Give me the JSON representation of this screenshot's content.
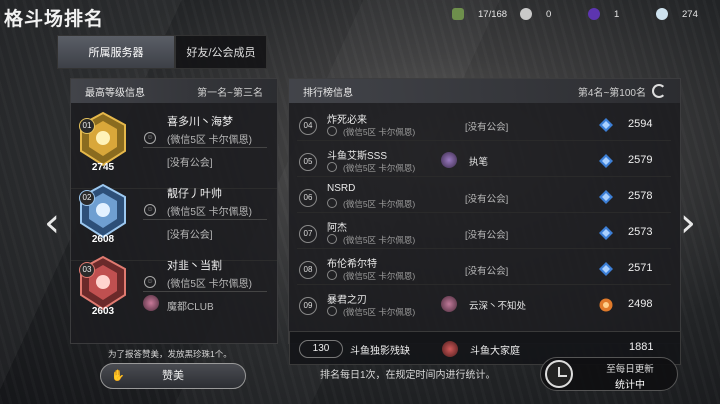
{
  "title": "格斗场排名",
  "resources": [
    {
      "icon": "green-box-icon",
      "value": "17/168",
      "color": "#7fa35a"
    },
    {
      "icon": "silver-ball-icon",
      "value": "0",
      "color": "#c9c9c9"
    },
    {
      "icon": "purple-gem-icon",
      "value": "1",
      "color": "#7a4bd3"
    },
    {
      "icon": "diamond-icon",
      "value": "274",
      "color": "#cfe3ef"
    }
  ],
  "tabs": [
    "所属服务器",
    "好友/公会成员"
  ],
  "left_panel": {
    "header": "最高等级信息",
    "range": "第一名~第三名",
    "top3": [
      {
        "rank": "01",
        "score": "2745",
        "name": "喜多川丶海梦",
        "server": "(微信5区 卡尔佩恩)",
        "guild": "[没有公会]",
        "color": "#e6b84a"
      },
      {
        "rank": "02",
        "score": "2608",
        "name": "靓仔丿叶帅",
        "server": "(微信5区 卡尔佩恩)",
        "guild": "[没有公会]",
        "color": "#7fb2e6"
      },
      {
        "rank": "03",
        "score": "2603",
        "name": "对韭丶当割",
        "server": "(微信5区 卡尔佩恩)",
        "guild": "魔都CLUB",
        "color": "#d0605a"
      }
    ]
  },
  "right_panel": {
    "header": "排行榜信息",
    "range": "第4名~第100名",
    "rows": [
      {
        "num": "04",
        "name": "炸死必来",
        "server": "(微信5区 卡尔佩恩)",
        "guild": "[没有公会]",
        "has_emblem": false,
        "points": "2594",
        "rank_color": "#3c7fd6"
      },
      {
        "num": "05",
        "name": "斗鱼艾斯SSS",
        "server": "(微信5区 卡尔佩恩)",
        "guild": "执笔",
        "has_emblem": true,
        "points": "2579",
        "rank_color": "#3c7fd6"
      },
      {
        "num": "06",
        "name": "NSRD",
        "server": "(微信5区 卡尔佩恩)",
        "guild": "[没有公会]",
        "has_emblem": false,
        "points": "2578",
        "rank_color": "#3c7fd6"
      },
      {
        "num": "07",
        "name": "阿杰",
        "server": "(微信5区 卡尔佩恩)",
        "guild": "[没有公会]",
        "has_emblem": false,
        "points": "2573",
        "rank_color": "#3c7fd6"
      },
      {
        "num": "08",
        "name": "布伦希尔特",
        "server": "(微信5区 卡尔佩恩)",
        "guild": "[没有公会]",
        "has_emblem": false,
        "points": "2571",
        "rank_color": "#3c7fd6"
      },
      {
        "num": "09",
        "name": "暴君之刃",
        "server": "(微信5区 卡尔佩恩)",
        "guild": "云深丶不知处",
        "has_emblem": true,
        "points": "2498",
        "rank_color": "#e07a2a"
      }
    ],
    "my_row": {
      "pos": "130",
      "name": "斗鱼独影残缺",
      "guild": "斗鱼大家庭",
      "points": "1881"
    }
  },
  "praise_note": "为了报答赞美，发放黑珍珠1个。",
  "praise_button": "赞美",
  "update_note": "排名每日1次，在规定时间内进行统计。",
  "update_box": {
    "line1": "至每日更新",
    "line2": "统计中"
  }
}
